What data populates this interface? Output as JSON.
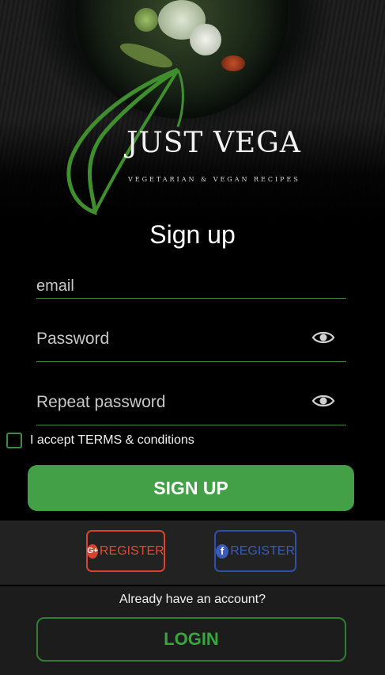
{
  "brand": {
    "title": "JUST VEGA",
    "subtitle": "VEGETARIAN & VEGAN RECIPES"
  },
  "form": {
    "heading": "Sign up",
    "email_placeholder": "email",
    "password_placeholder": "Password",
    "repeat_password_placeholder": "Repeat password",
    "terms_label": "I accept TERMS & conditions",
    "terms_checked": false,
    "submit_label": "SIGN UP"
  },
  "social": {
    "google_label": "REGISTER",
    "google_icon": "google-plus-icon",
    "google_icon_text": "G+",
    "facebook_label": "REGISTER",
    "facebook_icon": "facebook-icon",
    "facebook_icon_text": "f"
  },
  "footer": {
    "prompt": "Already have an account?",
    "login_label": "LOGIN"
  },
  "colors": {
    "accent": "#43a047",
    "google": "#d9432e",
    "facebook": "#3b5bb5"
  }
}
